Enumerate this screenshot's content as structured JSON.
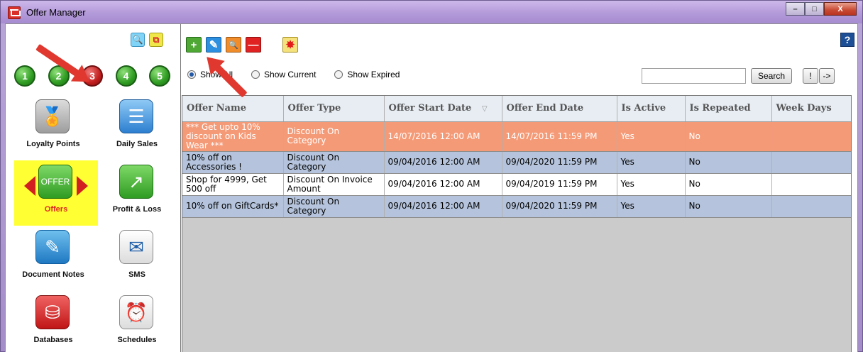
{
  "window": {
    "title": "Offer Manager",
    "buttons": {
      "minimize": "–",
      "maximize": "□",
      "close": "X"
    }
  },
  "left_panel": {
    "top_icons": [
      {
        "name": "search-icon",
        "glyph": "🔍"
      },
      {
        "name": "copy-icon",
        "glyph": "⧉"
      }
    ],
    "pages": [
      "1",
      "2",
      "3",
      "4",
      "5"
    ],
    "active_page": "3",
    "tiles": [
      {
        "label": "Loyalty Points",
        "icon": "loyalty-icon"
      },
      {
        "label": "Daily Sales",
        "icon": "daily-sales-icon"
      },
      {
        "label": "Offers",
        "icon": "offers-icon",
        "selected": true
      },
      {
        "label": "Profit & Loss",
        "icon": "profit-loss-icon"
      },
      {
        "label": "Document Notes",
        "icon": "document-notes-icon"
      },
      {
        "label": "SMS",
        "icon": "sms-icon"
      },
      {
        "label": "Databases",
        "icon": "databases-icon"
      },
      {
        "label": "Schedules",
        "icon": "schedules-icon"
      }
    ]
  },
  "toolbar": {
    "add": "+",
    "edit": "✎",
    "find": "🔍",
    "delete": "—",
    "special": "✸",
    "help": "?"
  },
  "filters": {
    "options": [
      "Show All",
      "Show Current",
      "Show Expired"
    ],
    "selected": "Show All"
  },
  "search": {
    "value": "",
    "button": "Search",
    "btn_bang": "!",
    "btn_go": "->"
  },
  "grid": {
    "columns": [
      "Offer Name",
      "Offer Type",
      "Offer Start Date",
      "Offer End Date",
      "Is Active",
      "Is Repeated",
      "Week Days"
    ],
    "rows": [
      {
        "style": "highlight",
        "cells": [
          "*** Get upto 10% discount on Kids Wear ***",
          "Discount On Category",
          "14/07/2016 12:00 AM",
          "14/07/2016 11:59 PM",
          "Yes",
          "No",
          ""
        ]
      },
      {
        "style": "blue",
        "cells": [
          "10% off on Accessories !",
          "Discount On Category",
          "09/04/2016 12:00 AM",
          "09/04/2020 11:59 PM",
          "Yes",
          "No",
          ""
        ]
      },
      {
        "style": "white",
        "cells": [
          "Shop for 4999, Get 500 off",
          "Discount On Invoice Amount",
          "09/04/2016 12:00 AM",
          "09/04/2019 11:59 PM",
          "Yes",
          "No",
          ""
        ]
      },
      {
        "style": "blue",
        "cells": [
          "10% off  on GiftCards*",
          "Discount On Category",
          "09/04/2016 12:00 AM",
          "09/04/2020 11:59 PM",
          "Yes",
          "No",
          ""
        ]
      }
    ]
  },
  "colors": {
    "highlight_row": "#f59a77",
    "alt_row": "#b5c4dc",
    "annotation_arrow": "#e0382e"
  }
}
